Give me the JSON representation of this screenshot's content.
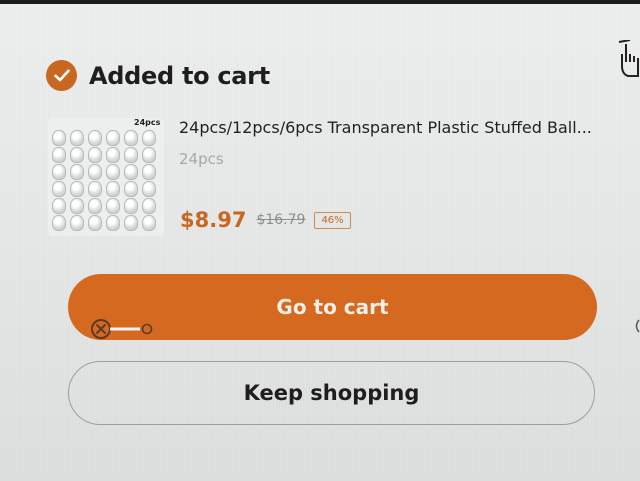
{
  "header": {
    "title": "Added to cart",
    "check_icon": "check-circle-icon"
  },
  "product": {
    "thumbnail_label": "24pcs",
    "title": "24pcs/12pcs/6pcs Transparent Plastic Stuffed Ball...",
    "variant": "24pcs",
    "price": "$8.97",
    "original_price": "$16.79",
    "discount": "46%"
  },
  "actions": {
    "go_to_cart": "Go to cart",
    "keep_shopping": "Keep shopping"
  },
  "colors": {
    "accent": "#d4691f",
    "price": "#c9661f"
  }
}
